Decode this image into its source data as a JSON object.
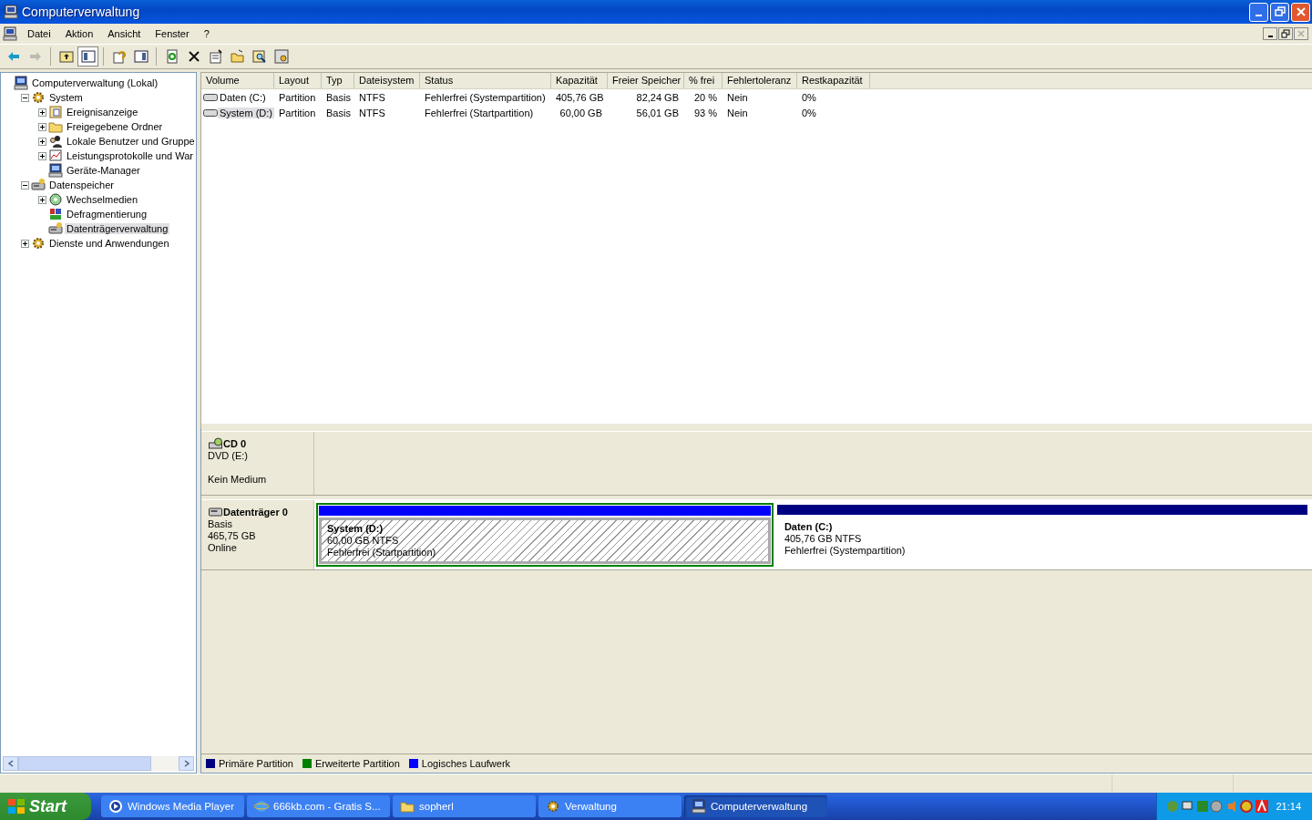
{
  "window": {
    "title": "Computerverwaltung"
  },
  "menu": [
    "Datei",
    "Aktion",
    "Ansicht",
    "Fenster",
    "?"
  ],
  "toolbar": [
    [
      {
        "kind": "back",
        "disabled": false,
        "pressed": false
      },
      {
        "kind": "forward",
        "disabled": true,
        "pressed": false
      }
    ],
    [
      {
        "kind": "up",
        "disabled": false,
        "pressed": false
      },
      {
        "kind": "tree",
        "disabled": false,
        "pressed": true
      }
    ],
    [
      {
        "kind": "help",
        "disabled": false,
        "pressed": false
      },
      {
        "kind": "pane",
        "disabled": false,
        "pressed": false
      }
    ],
    [
      {
        "kind": "refresh",
        "disabled": false,
        "pressed": false
      },
      {
        "kind": "delete",
        "disabled": false,
        "pressed": false
      },
      {
        "kind": "properties",
        "disabled": false,
        "pressed": false
      },
      {
        "kind": "open",
        "disabled": false,
        "pressed": false
      },
      {
        "kind": "search",
        "disabled": false,
        "pressed": false
      },
      {
        "kind": "settings",
        "disabled": false,
        "pressed": false
      }
    ]
  ],
  "tree": [
    {
      "label": "Computerverwaltung (Lokal)",
      "kind": "computer",
      "selected": false,
      "children": [
        {
          "label": "System",
          "kind": "tools",
          "expanded": true,
          "selected": false,
          "children": [
            {
              "label": "Ereignisanzeige",
              "kind": "log",
              "expanded": false,
              "selected": false
            },
            {
              "label": "Freigegebene Ordner",
              "kind": "folder",
              "expanded": false,
              "selected": false
            },
            {
              "label": "Lokale Benutzer und Gruppe",
              "kind": "users",
              "expanded": false,
              "selected": false
            },
            {
              "label": "Leistungsprotokolle und War",
              "kind": "chart",
              "expanded": false,
              "selected": false
            },
            {
              "label": "Geräte-Manager",
              "kind": "computer",
              "selected": false
            }
          ]
        },
        {
          "label": "Datenspeicher",
          "kind": "storage",
          "expanded": true,
          "selected": false,
          "children": [
            {
              "label": "Wechselmedien",
              "kind": "media",
              "expanded": false,
              "selected": false
            },
            {
              "label": "Defragmentierung",
              "kind": "defrag",
              "selected": false
            },
            {
              "label": "Datenträgerverwaltung",
              "kind": "disk",
              "selected": true
            }
          ]
        },
        {
          "label": "Dienste und Anwendungen",
          "kind": "services",
          "expanded": false,
          "selected": false
        }
      ]
    }
  ],
  "table": {
    "columns": [
      "Volume",
      "Layout",
      "Typ",
      "Dateisystem",
      "Status",
      "Kapazität",
      "Freier Speicher",
      "% frei",
      "Fehlertoleranz",
      "Restkapazität"
    ],
    "rows": [
      {
        "selected": false,
        "cells": [
          "Daten (C:)",
          "Partition",
          "Basis",
          "NTFS",
          "Fehlerfrei (Systempartition)",
          "405,76 GB",
          "82,24 GB",
          "20 %",
          "Nein",
          "0%"
        ]
      },
      {
        "selected": true,
        "cells": [
          "System (D:)",
          "Partition",
          "Basis",
          "NTFS",
          "Fehlerfrei (Startpartition)",
          "60,00 GB",
          "56,01 GB",
          "93 %",
          "Nein",
          "0%"
        ]
      }
    ]
  },
  "disks": [
    {
      "kind": "cd",
      "name": "CD 0",
      "lines": [
        "DVD (E:)",
        "Kein Medium"
      ]
    },
    {
      "kind": "disk",
      "name": "Datenträger 0",
      "lines": [
        "Basis",
        "465,75 GB",
        "Online"
      ],
      "partitions": [
        {
          "name": "System  (D:)",
          "size": "60,00 GB NTFS",
          "status": "Fehlerfrei (Startpartition)",
          "color": "#0000ff",
          "extended": true,
          "selected": true
        },
        {
          "name": "Daten  (C:)",
          "size": "405,76 GB NTFS",
          "status": "Fehlerfrei (Systempartition)",
          "color": "#000080",
          "extended": false,
          "selected": false
        }
      ]
    }
  ],
  "legend": [
    {
      "label": "Primäre Partition",
      "color": "#000080"
    },
    {
      "label": "Erweiterte Partition",
      "color": "#008000"
    },
    {
      "label": "Logisches Laufwerk",
      "color": "#0000ff"
    }
  ],
  "taskbar": {
    "start": "Start",
    "tasks": [
      {
        "label": "Windows Media Player",
        "kind": "media",
        "selected": false
      },
      {
        "label": "666kb.com - Gratis S...",
        "kind": "browser",
        "selected": false
      },
      {
        "label": "sopherl",
        "kind": "folder",
        "selected": false
      },
      {
        "label": "Verwaltung",
        "kind": "tools",
        "selected": false
      },
      {
        "label": "Computerverwaltung",
        "kind": "computer",
        "selected": true
      }
    ],
    "clock": "21:14"
  }
}
